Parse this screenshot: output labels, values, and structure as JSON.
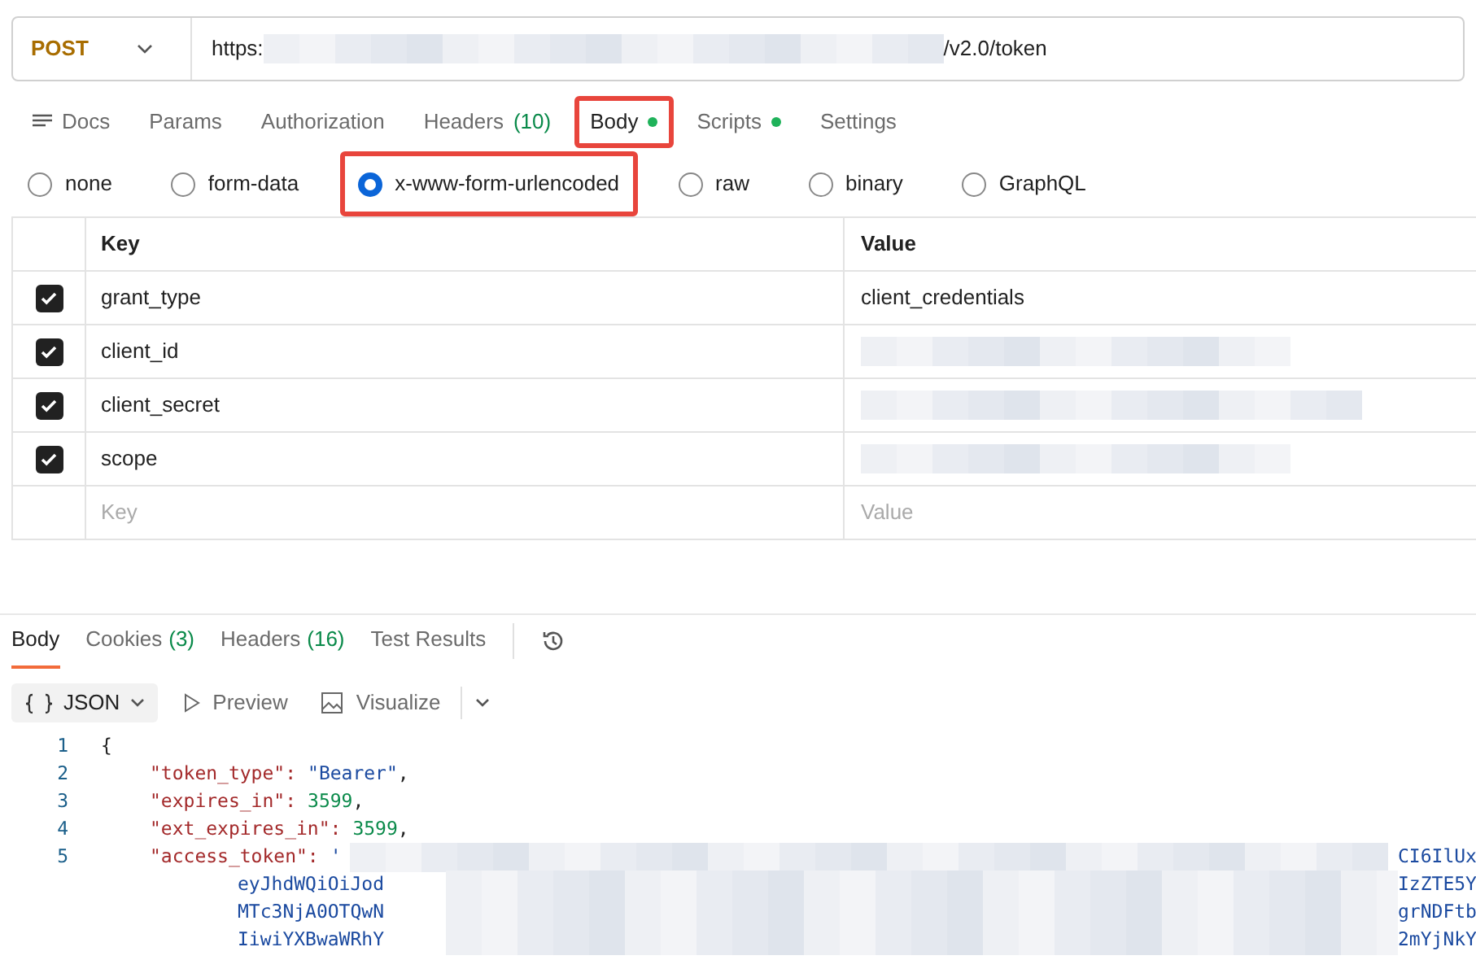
{
  "request": {
    "method": "POST",
    "url_start": "https:",
    "url_end": "/v2.0/token"
  },
  "tabs": [
    {
      "label": "Docs",
      "kind": "docs",
      "selected": false,
      "highlighted": false
    },
    {
      "label": "Params",
      "kind": "plain",
      "selected": false,
      "highlighted": false
    },
    {
      "label": "Authorization",
      "kind": "plain",
      "selected": false,
      "highlighted": false
    },
    {
      "label": "Headers",
      "count": "(10)",
      "kind": "plain",
      "selected": false,
      "highlighted": false
    },
    {
      "label": "Body",
      "kind": "dot",
      "selected": true,
      "highlighted": true
    },
    {
      "label": "Scripts",
      "kind": "dot",
      "selected": false,
      "highlighted": false
    },
    {
      "label": "Settings",
      "kind": "plain",
      "selected": false,
      "highlighted": false
    }
  ],
  "body_types": [
    {
      "label": "none",
      "selected": false,
      "highlighted": false
    },
    {
      "label": "form-data",
      "selected": false,
      "highlighted": false
    },
    {
      "label": "x-www-form-urlencoded",
      "selected": true,
      "highlighted": true
    },
    {
      "label": "raw",
      "selected": false,
      "highlighted": false
    },
    {
      "label": "binary",
      "selected": false,
      "highlighted": false
    },
    {
      "label": "GraphQL",
      "selected": false,
      "highlighted": false
    }
  ],
  "table": {
    "columns": [
      "Key",
      "Value"
    ],
    "rows": [
      {
        "key": "grant_type",
        "value": "client_credentials",
        "checked": true
      },
      {
        "key": "client_id",
        "checked": true
      },
      {
        "key": "client_secret",
        "checked": true
      },
      {
        "key": "scope",
        "checked": true
      }
    ],
    "new_row": {
      "key_placeholder": "Key",
      "value_placeholder": "Value"
    }
  },
  "response_tabs": [
    {
      "label": "Body",
      "selected": true
    },
    {
      "label": "Cookies",
      "count": "(3)",
      "selected": false
    },
    {
      "label": "Headers",
      "count": "(16)",
      "selected": false
    },
    {
      "label": "Test Results",
      "selected": false
    }
  ],
  "format": {
    "selector": "JSON",
    "preview": "Preview",
    "visualize": "Visualize"
  },
  "code": [
    {
      "number": "1",
      "kind": "punct",
      "text": "{"
    },
    {
      "number": "2",
      "kind": "string",
      "key": "\"token_type\":",
      "value": "\"Bearer\"",
      "end": ","
    },
    {
      "number": "3",
      "kind": "number",
      "key": "\"expires_in\":",
      "value": "3599",
      "end": ","
    },
    {
      "number": "4",
      "kind": "number",
      "key": "\"ext_expires_in\":",
      "value": "3599",
      "end": ","
    },
    {
      "number": "5",
      "kind": "redacted",
      "key": "\"access_token\":",
      "value": "'",
      "tail": "CI6IlUx"
    },
    {
      "kind": "wrap",
      "value": "eyJhdWQiOiJod",
      "tail": "IzZTE5Y"
    },
    {
      "kind": "wrap",
      "value": "MTc3NjA0OTQwN",
      "tail": "grNDFtb"
    },
    {
      "kind": "wrap",
      "value": "IiwiYXBwaWRhY",
      "tail": "2mYjNkY"
    }
  ]
}
